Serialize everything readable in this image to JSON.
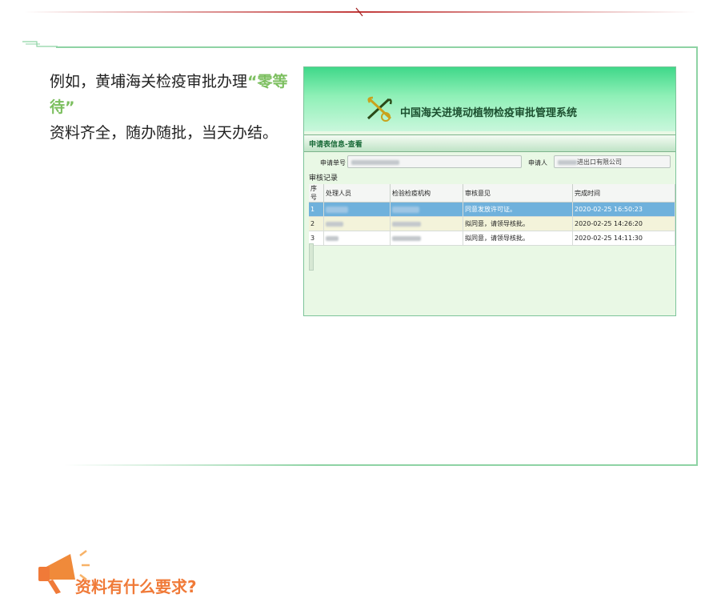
{
  "intro": {
    "line1": "例如，黄埔海关检疫审批办理",
    "highlight": "“零等待”",
    "line2": "资料齐全，随办随批，当天办结。"
  },
  "screenshot": {
    "banner_title": "中国海关进境动植物检疫审批管理系统",
    "section_title": "申请表信息-查看",
    "form": {
      "application_no_label": "申请单号",
      "applicant_label": "申请人",
      "applicant_suffix": "进出口有限公司"
    },
    "records_title": "审核记录",
    "table": {
      "headers": [
        "序号",
        "处理人员",
        "检验检疫机构",
        "审核意见",
        "完成时间"
      ],
      "rows": [
        {
          "no": "1",
          "opinion": "同意发放许可证。",
          "time": "2020-02-25 16:50:23"
        },
        {
          "no": "2",
          "opinion": "拟同意，请领导核批。",
          "time": "2020-02-25 14:26:20"
        },
        {
          "no": "3",
          "opinion": "拟同意，请领导核批。",
          "time": "2020-02-25 14:11:30"
        }
      ]
    }
  },
  "bottom_heading": "资料有什么要求?",
  "colors": {
    "highlight": "#7cbf5f",
    "frame": "#8ed3a4",
    "heading": "#f07a38",
    "selected_row": "#6fb1dc"
  },
  "icons": [
    "emblem-icon",
    "megaphone-icon",
    "corner-ornament-icon"
  ]
}
